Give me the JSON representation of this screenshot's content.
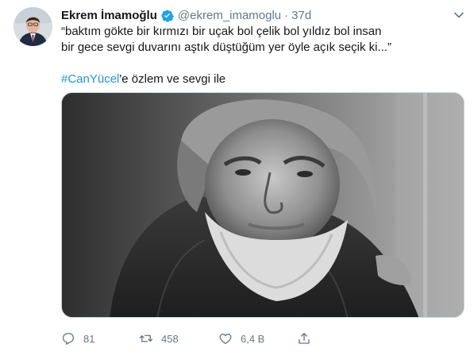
{
  "tweet": {
    "author_name": "Ekrem İmamoğlu",
    "author_handle": "@ekrem_imamoglu",
    "separator": "·",
    "time": "37d",
    "line1": "“baktım gökte bir kırmızı bir uçak bol çelik bol yıldız bol insan",
    "line2": "bir gece sevgi duvarını aştık düştüğüm yer öyle açık seçik ki...”",
    "hashtag": "#CanYücel",
    "hashtag_suffix": "'e özlem ve sevgi ile"
  },
  "actions": {
    "reply_count": "81",
    "retweet_count": "458",
    "like_count": "6,4 B"
  },
  "icons": {
    "verified": "verified-badge-icon",
    "more": "chevron-down-icon",
    "reply": "reply-icon",
    "retweet": "retweet-icon",
    "like": "heart-icon",
    "share": "share-icon"
  },
  "colors": {
    "link": "#1b95e0",
    "secondary": "#657786",
    "verified": "#1da1f2"
  }
}
